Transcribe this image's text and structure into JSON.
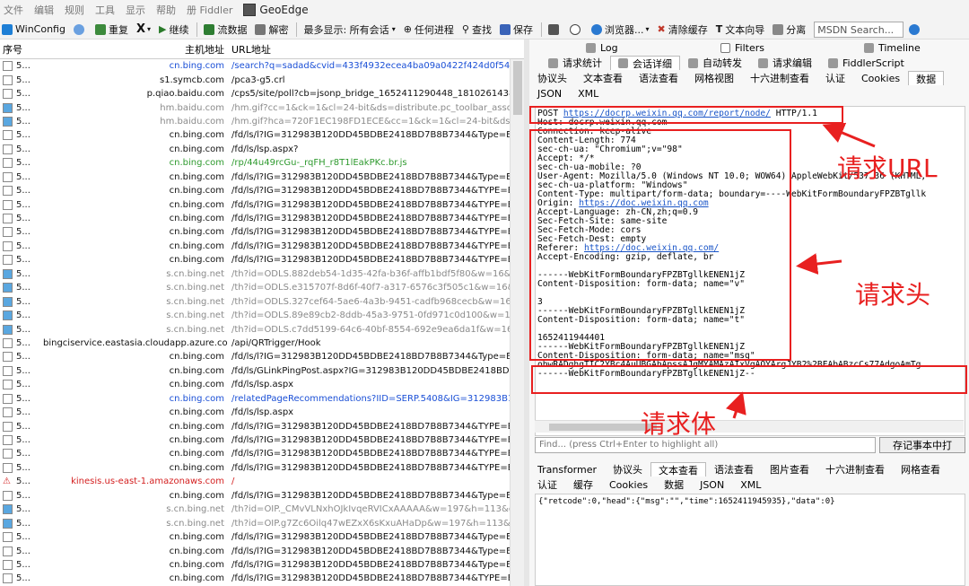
{
  "menu": {
    "items": [
      "文件",
      "编辑",
      "规则",
      "工具",
      "显示",
      "帮助",
      "册 Fiddler"
    ],
    "geoedge": "GeoEdge"
  },
  "toolbar": {
    "winconfig": "WinConfig",
    "replay": "重复",
    "remove": "X",
    "go": "继续",
    "stream": "流数据",
    "decode": "解密",
    "keep": "最多显示: 所有会话",
    "process": "任何进程",
    "find": "查找",
    "save": "保存",
    "browse": "浏览器...",
    "clearcache": "清除缓存",
    "textwizard": "文本向导",
    "tearoff": "分离",
    "msdn": "MSDN Search...",
    "icons": [
      "windows-icon",
      "comment-icon",
      "replay-icon",
      "close-icon",
      "play-icon",
      "stream-icon",
      "decode-icon",
      "target-icon",
      "binoculars-icon",
      "save-icon",
      "camera-icon",
      "timer-icon",
      "ie-icon",
      "clear-icon",
      "text-icon",
      "tearoff-icon",
      "help-icon"
    ]
  },
  "sessions": {
    "col_num": "序号",
    "col_host": "主机地址",
    "col_url": "URL地址",
    "rows": [
      {
        "num": "5...",
        "host": "cn.bing.com",
        "url": "/search?q=sadad&cvid=433f4932ecea4ba09a0422f424d0f54c&aqs=e",
        "color": "#1a4fd6"
      },
      {
        "num": "5...",
        "host": "s1.symcb.com",
        "url": "/pca3-g5.crl",
        "color": "#111111"
      },
      {
        "num": "5...",
        "host": "p.qiao.baidu.com",
        "url": "/cps5/site/poll?cb=jsonp_bridge_1652411290448_1810261438855696",
        "color": "#111111"
      },
      {
        "num": "5...",
        "host": "hm.baidu.com",
        "url": "/hm.gif?cc=1&ck=1&cl=24-bit&ds=distribute.pc_toolbar_associatewor",
        "color": "#8a8a8a"
      },
      {
        "num": "5...",
        "host": "hm.baidu.com",
        "url": "/hm.gif?hca=720F1EC198FD1ECE&cc=1&ck=1&cl=24-bit&ds=distribut",
        "color": "#8a8a8a"
      },
      {
        "num": "5...",
        "host": "cn.bing.com",
        "url": "/fd/ls/l?IG=312983B120DD45BDBE2418BD7B8B7344&Type=Event.CPT",
        "color": "#111111"
      },
      {
        "num": "5...",
        "host": "cn.bing.com",
        "url": "/fd/ls/lsp.aspx?",
        "color": "#111111"
      },
      {
        "num": "5...",
        "host": "cn.bing.com",
        "url": "/rp/44u49rcGu-_rqFH_r8T1lEakPKc.br.js",
        "color": "#2e9a2e"
      },
      {
        "num": "5...",
        "host": "cn.bing.com",
        "url": "/fd/ls/l?IG=312983B120DD45BDBE2418BD7B8B7344&Type=Event.Clie",
        "color": "#111111"
      },
      {
        "num": "5...",
        "host": "cn.bing.com",
        "url": "/fd/ls/l?IG=312983B120DD45BDBE2418BD7B8B7344&TYPE=Event.Clie",
        "color": "#111111"
      },
      {
        "num": "5...",
        "host": "cn.bing.com",
        "url": "/fd/ls/l?IG=312983B120DD45BDBE2418BD7B8B7344&TYPE=Event.Clie",
        "color": "#111111"
      },
      {
        "num": "5...",
        "host": "cn.bing.com",
        "url": "/fd/ls/l?IG=312983B120DD45BDBE2418BD7B8B7344&TYPE=Event.Clie",
        "color": "#111111"
      },
      {
        "num": "5...",
        "host": "cn.bing.com",
        "url": "/fd/ls/l?IG=312983B120DD45BDBE2418BD7B8B7344&TYPE=Event.Clie",
        "color": "#111111"
      },
      {
        "num": "5...",
        "host": "cn.bing.com",
        "url": "/fd/ls/l?IG=312983B120DD45BDBE2418BD7B8B7344&TYPE=Event.Clie",
        "color": "#111111"
      },
      {
        "num": "5...",
        "host": "cn.bing.com",
        "url": "/fd/ls/l?IG=312983B120DD45BDBE2418BD7B8B7344&TYPE=Event.Clie",
        "color": "#111111"
      },
      {
        "num": "5...",
        "host": "s.cn.bing.net",
        "url": "/th?id=ODLS.882deb54-1d35-42fa-b36f-affb1bdf5f80&w=16&h=16&",
        "color": "#8a8a8a"
      },
      {
        "num": "5...",
        "host": "s.cn.bing.net",
        "url": "/th?id=ODLS.e315707f-8d6f-40f7-a317-6576c3f505c1&w=16&h=16&",
        "color": "#8a8a8a"
      },
      {
        "num": "5...",
        "host": "s.cn.bing.net",
        "url": "/th?id=ODLS.327cef64-5ae6-4a3b-9451-cadfb968cecb&w=16&h=16",
        "color": "#8a8a8a"
      },
      {
        "num": "5...",
        "host": "s.cn.bing.net",
        "url": "/th?id=ODLS.89e89cb2-8ddb-45a3-9751-0fd971c0d100&w=16&h=16&",
        "color": "#8a8a8a"
      },
      {
        "num": "5...",
        "host": "s.cn.bing.net",
        "url": "/th?id=ODLS.c7dd5199-64c6-40bf-8554-692e9ea6da1f&w=16&h=16",
        "color": "#8a8a8a"
      },
      {
        "num": "5...",
        "host": "bingciservice.eastasia.cloudapp.azure.com",
        "url": "/api/QRTrigger/Hook",
        "color": "#111111"
      },
      {
        "num": "5...",
        "host": "cn.bing.com",
        "url": "/fd/ls/l?IG=312983B120DD45BDBE2418BD7B8B7344&Type=Event.PPT",
        "color": "#111111"
      },
      {
        "num": "5...",
        "host": "cn.bing.com",
        "url": "/fd/ls/GLinkPingPost.aspx?IG=312983B120DD45BDBE2418BD7B8B7344",
        "color": "#111111"
      },
      {
        "num": "5...",
        "host": "cn.bing.com",
        "url": "/fd/ls/lsp.aspx",
        "color": "#111111"
      },
      {
        "num": "5...",
        "host": "cn.bing.com",
        "url": "/relatedPageRecommendations?IID=SERP.5408&IG=312983B120DD45",
        "color": "#1a4fd6"
      },
      {
        "num": "5...",
        "host": "cn.bing.com",
        "url": "/fd/ls/lsp.aspx",
        "color": "#111111"
      },
      {
        "num": "5...",
        "host": "cn.bing.com",
        "url": "/fd/ls/l?IG=312983B120DD45BDBE2418BD7B8B7344&TYPE=Event.Clie",
        "color": "#111111"
      },
      {
        "num": "5...",
        "host": "cn.bing.com",
        "url": "/fd/ls/l?IG=312983B120DD45BDBE2418BD7B8B7344&TYPE=Event.Clie",
        "color": "#111111"
      },
      {
        "num": "5...",
        "host": "cn.bing.com",
        "url": "/fd/ls/l?IG=312983B120DD45BDBE2418BD7B8B7344&TYPE=Event.Clie",
        "color": "#111111"
      },
      {
        "num": "5...",
        "host": "cn.bing.com",
        "url": "/fd/ls/l?IG=312983B120DD45BDBE2418BD7B8B7344&TYPE=Event.Clie",
        "color": "#111111"
      },
      {
        "num": "5...",
        "host": "kinesis.us-east-1.amazonaws.com",
        "url": "/",
        "color": "#d42020"
      },
      {
        "num": "5...",
        "host": "cn.bing.com",
        "url": "/fd/ls/l?IG=312983B120DD45BDBE2418BD7B8B7344&Type=Event.Clie",
        "color": "#111111"
      },
      {
        "num": "5...",
        "host": "s.cn.bing.net",
        "url": "/th?id=OIP._CMvVLNxhOJkIvqeRVICxAAAAA&w=197&h=113&c=7&o",
        "color": "#8a8a8a"
      },
      {
        "num": "5...",
        "host": "s.cn.bing.net",
        "url": "/th?id=OIP.g7Zc6Oilq47wEZxX6sKxuAHaDp&w=197&h=113&c=7&o=",
        "color": "#8a8a8a"
      },
      {
        "num": "5...",
        "host": "cn.bing.com",
        "url": "/fd/ls/l?IG=312983B120DD45BDBE2418BD7B8B7344&Type=Event.Clie",
        "color": "#111111"
      },
      {
        "num": "5...",
        "host": "cn.bing.com",
        "url": "/fd/ls/l?IG=312983B120DD45BDBE2418BD7B8B7344&Type=Event.Clie",
        "color": "#111111"
      },
      {
        "num": "5...",
        "host": "cn.bing.com",
        "url": "/fd/ls/l?IG=312983B120DD45BDBE2418BD7B8B7344&Type=Event.Clie",
        "color": "#111111"
      },
      {
        "num": "5...",
        "host": "cn.bing.com",
        "url": "/fd/ls/l?IG=312983B120DD45BDBE2418BD7B8B7344&TYPE=Event.Tab",
        "color": "#111111"
      }
    ]
  },
  "inspector": {
    "top_tabs": [
      "Log",
      "Filters",
      "Timeline"
    ],
    "main_tabs": [
      "请求统计",
      "会话详细",
      "自动转发",
      "请求编辑",
      "FiddlerScript"
    ],
    "req_tabs": [
      "协议头",
      "文本查看",
      "语法查看",
      "网格视图",
      "十六进制查看",
      "认证",
      "Cookies",
      "数据"
    ],
    "req_tabs2": [
      "JSON",
      "XML"
    ],
    "request": {
      "method": "POST",
      "url": "https://docrp.weixin.qq.com/report/node/",
      "proto": "HTTP/1.1",
      "headers_text": "Host: docrp.weixin.qq.com\nConnection: keep-alive\nContent-Length: 774\nsec-ch-ua: \"Chromium\";v=\"98\"\nAccept: */*\nsec-ch-ua-mobile: ?0\nUser-Agent: Mozilla/5.0 (Windows NT 10.0; WOW64) AppleWebKit/537.36 (KHTML,\nsec-ch-ua-platform: \"Windows\"\nContent-Type: multipart/form-data; boundary=----WebKitFormBoundaryFPZBTgllk",
      "origin_label": "Origin: ",
      "origin_url": "https://doc.weixin.qq.com",
      "headers_text2": "Accept-Language: zh-CN,zh;q=0.9\nSec-Fetch-Site: same-site\nSec-Fetch-Mode: cors\nSec-Fetch-Dest: empty",
      "referer_label": "Referer: ",
      "referer_url": "https://doc.weixin.qq.com/",
      "headers_text3": "Accept-Encoding: gzip, deflate, br\n\n------WebKitFormBoundaryFPZBTgllkENEN1jZ\nContent-Disposition: form-data; name=\"v\"\n\n3\n------WebKitFormBoundaryFPZBTgllkENEN1jZ\nContent-Disposition: form-data; name=\"t\"\n\n1652411944401\n------WebKitFormBoundaryFPZBTgllkENEN1jZ\nContent-Disposition: form-data; name=\"msg\"",
      "body_text": "obwRADghgTIC2YBc4AuUBGAbApssAJgMYAMAzAIxVgAOYArgJYB2%2BFAbABzcCs77AdgoAmTg\n------WebKitFormBoundaryFPZBTgllkENEN1jZ--"
    },
    "find_placeholder": "Find... (press Ctrl+Enter to highlight all)",
    "find_button": "存记事本中打",
    "resp_tabs": [
      "Transformer",
      "协议头",
      "文本查看",
      "语法查看",
      "图片查看",
      "十六进制查看",
      "网格查看"
    ],
    "resp_tabs2": [
      "认证",
      "缓存",
      "Cookies",
      "数据",
      "JSON",
      "XML"
    ],
    "response": "{\"retcode\":0,\"head\":{\"msg\":\"\",\"time\":1652411945935},\"data\":0}"
  },
  "annotations": {
    "url": "请求URL",
    "header": "请求头",
    "body": "请求体"
  },
  "colors": {
    "annotation": "#e82020"
  }
}
